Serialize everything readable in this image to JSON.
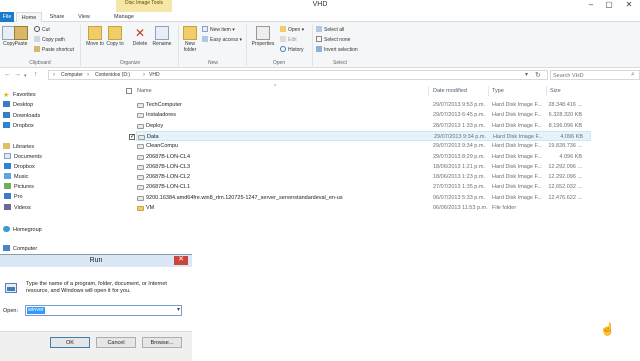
{
  "window": {
    "title": "VHD",
    "context_tab": "Disc Image Tools"
  },
  "tabs": [
    "File",
    "Home",
    "Share",
    "View",
    "Manage"
  ],
  "ribbon": {
    "clipboard": {
      "group": "Clipboard",
      "copy": "Copy",
      "paste": "Paste",
      "cut": "Cut",
      "copy_path": "Copy path",
      "paste_shortcut": "Paste shortcut"
    },
    "organize": {
      "group": "Organize",
      "move_to": "Move to",
      "copy_to": "Copy to",
      "delete": "Delete",
      "rename": "Rename"
    },
    "new": {
      "group": "New",
      "new_folder": "New folder",
      "new_item": "New item",
      "easy_access": "Easy access"
    },
    "open": {
      "group": "Open",
      "properties": "Properties",
      "open": "Open",
      "edit": "Edit",
      "history": "History"
    },
    "select": {
      "group": "Select",
      "select_all": "Select all",
      "select_none": "Select none",
      "invert_selection": "Invert selection"
    }
  },
  "address": {
    "crumbs": [
      "Computer",
      "Contenidos (D:)",
      "VHD"
    ],
    "search_placeholder": "Search VHD"
  },
  "navpane": {
    "favorites": "Favorites",
    "fav_items": [
      "Desktop",
      "Downloads",
      "Dropbox"
    ],
    "libraries": "Libraries",
    "lib_items": [
      "Documents",
      "Dropbox",
      "Music",
      "Pictures",
      "Pro",
      "Videos"
    ],
    "homegroup": "Homegroup",
    "computer": "Computer"
  },
  "columns": [
    "Name",
    "Date modified",
    "Type",
    "Size"
  ],
  "files": [
    {
      "name": "TechComputer",
      "date": "29/07/2013 9:53 p.m.",
      "type": "Hard Disk Image F...",
      "size": "28.348.416 ...",
      "folder": false,
      "selected": false
    },
    {
      "name": "Instaladores",
      "date": "29/07/2013 6:45 p.m.",
      "type": "Hard Disk Image F...",
      "size": "6.328.320 KB",
      "folder": false,
      "selected": false
    },
    {
      "name": "Deploy",
      "date": "28/07/2013 1:33 p.m.",
      "type": "Hard Disk Image F...",
      "size": "8.196.096 KB",
      "folder": false,
      "selected": false
    },
    {
      "name": "Data",
      "date": "29/07/2013 9:34 p.m.",
      "type": "Hard Disk Image F...",
      "size": "4.096 KB",
      "folder": false,
      "selected": true
    },
    {
      "name": "CleanCompu",
      "date": "29/07/2013 9:34 p.m.",
      "type": "Hard Disk Image F...",
      "size": "19.828.736 ...",
      "folder": false,
      "selected": false
    },
    {
      "name": "20687B-LON-CL4",
      "date": "29/07/2013 8:29 p.m.",
      "type": "Hard Disk Image F...",
      "size": "4.096 KB",
      "folder": false,
      "selected": false
    },
    {
      "name": "20687B-LON-CL3",
      "date": "18/06/2013 1:21 p.m.",
      "type": "Hard Disk Image F...",
      "size": "12.292.096 ...",
      "folder": false,
      "selected": false
    },
    {
      "name": "20687B-LON-CL2",
      "date": "18/06/2013 1:23 p.m.",
      "type": "Hard Disk Image F...",
      "size": "12.292.096 ...",
      "folder": false,
      "selected": false
    },
    {
      "name": "20687B-LON-CL1",
      "date": "27/07/2013 1:35 p.m.",
      "type": "Hard Disk Image F...",
      "size": "12.652.032 ...",
      "folder": false,
      "selected": false
    },
    {
      "name": "9200.16384.amd64fre.win8_rtm.120725-1247_server_serverstandardeval_en-us",
      "date": "06/07/2013 5:33 p.m.",
      "type": "Hard Disk Image F...",
      "size": "12.476.622 ...",
      "folder": false,
      "selected": false
    },
    {
      "name": "VM",
      "date": "06/06/2013 11:53 p.m.",
      "type": "File folder",
      "size": "",
      "folder": true,
      "selected": false
    }
  ],
  "run": {
    "title": "Run",
    "description": "Type the name of a program, folder, document, or Internet resource, and Windows will open it for you.",
    "open_label": "Open:",
    "input_value": "winver",
    "ok": "OK",
    "cancel": "Cancel",
    "browse": "Browse..."
  }
}
